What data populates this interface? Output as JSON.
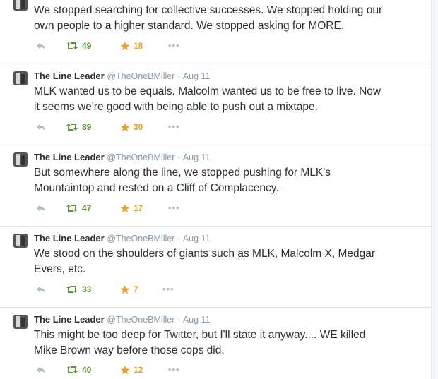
{
  "tweets": [
    {
      "name": "",
      "handle": "",
      "time": "",
      "text_lines": [
        "We stopped searching for collective successes. We stopped holding our",
        "own people to a higher standard. We stopped asking for MORE."
      ],
      "retweets": "49",
      "favorites": "18"
    },
    {
      "name": "The Line Leader",
      "handle": "@TheOneBMiller",
      "sep": "·",
      "time": "Aug 11",
      "text_lines": [
        "MLK wanted us to be equals. Malcolm wanted us to be free to live. Now",
        "it seems we're good with being able to push out a mixtape."
      ],
      "retweets": "89",
      "favorites": "30"
    },
    {
      "name": "The Line Leader",
      "handle": "@TheOneBMiller",
      "sep": "·",
      "time": "Aug 11",
      "text_lines": [
        "But somewhere along the line, we stopped pushing for MLK's",
        "Mountaintop and rested on a Cliff of Complacency."
      ],
      "retweets": "47",
      "favorites": "17"
    },
    {
      "name": "The Line Leader",
      "handle": "@TheOneBMiller",
      "sep": "·",
      "time": "Aug 11",
      "text_lines": [
        "We stood on the shoulders of giants such as MLK, Malcolm X, Medgar",
        "Evers, etc."
      ],
      "retweets": "33",
      "favorites": "7"
    },
    {
      "name": "The Line Leader",
      "handle": "@TheOneBMiller",
      "sep": "·",
      "time": "Aug 11",
      "text_lines": [
        "This might be too deep for Twitter, but I'll state it anyway.... WE killed",
        "Mike Brown way before those cops did."
      ],
      "retweets": "40",
      "favorites": "12"
    }
  ],
  "icons": {
    "reply": "reply-icon",
    "retweet": "retweet-icon",
    "favorite": "star-icon",
    "more": "more-icon",
    "more_glyph": "•••"
  },
  "colors": {
    "retweet": "#5c913b",
    "favorite": "#e7a22b",
    "muted": "#8899a6",
    "text": "#292f33",
    "border": "#e1e8ed"
  }
}
